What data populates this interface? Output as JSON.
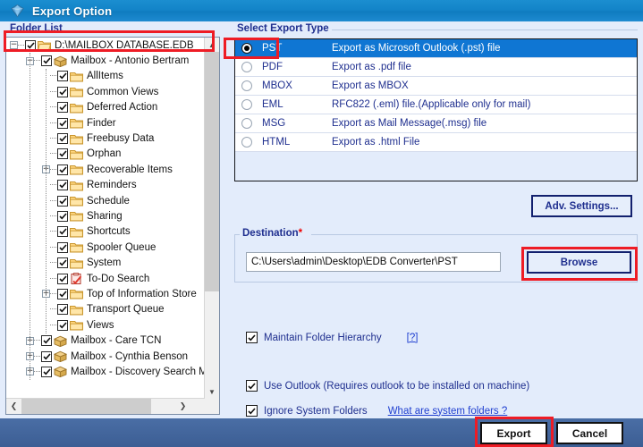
{
  "window": {
    "title": "Export Option",
    "icon": "gem-icon"
  },
  "left": {
    "group_label": "Folder List",
    "tree": [
      {
        "label": "D:\\MAILBOX DATABASE.EDB",
        "depth": 0,
        "expander": "minus",
        "icon": "open-folder-icon",
        "checked": true
      },
      {
        "label": "Mailbox - Antonio Bertram",
        "depth": 1,
        "expander": "minus",
        "icon": "mailbox-icon",
        "checked": true
      },
      {
        "label": "AllItems",
        "depth": 2,
        "expander": "none",
        "icon": "folder-icon",
        "checked": true
      },
      {
        "label": "Common Views",
        "depth": 2,
        "expander": "none",
        "icon": "folder-icon",
        "checked": true
      },
      {
        "label": "Deferred Action",
        "depth": 2,
        "expander": "none",
        "icon": "folder-icon",
        "checked": true
      },
      {
        "label": "Finder",
        "depth": 2,
        "expander": "none",
        "icon": "folder-icon",
        "checked": true
      },
      {
        "label": "Freebusy Data",
        "depth": 2,
        "expander": "none",
        "icon": "folder-icon",
        "checked": true
      },
      {
        "label": "Orphan",
        "depth": 2,
        "expander": "none",
        "icon": "folder-icon",
        "checked": true
      },
      {
        "label": "Recoverable Items",
        "depth": 2,
        "expander": "plus",
        "icon": "folder-icon",
        "checked": true
      },
      {
        "label": "Reminders",
        "depth": 2,
        "expander": "none",
        "icon": "folder-icon",
        "checked": true
      },
      {
        "label": "Schedule",
        "depth": 2,
        "expander": "none",
        "icon": "folder-icon",
        "checked": true
      },
      {
        "label": "Sharing",
        "depth": 2,
        "expander": "none",
        "icon": "folder-icon",
        "checked": true
      },
      {
        "label": "Shortcuts",
        "depth": 2,
        "expander": "none",
        "icon": "folder-icon",
        "checked": true
      },
      {
        "label": "Spooler Queue",
        "depth": 2,
        "expander": "none",
        "icon": "folder-icon",
        "checked": true
      },
      {
        "label": "System",
        "depth": 2,
        "expander": "none",
        "icon": "folder-icon",
        "checked": true
      },
      {
        "label": "To-Do Search",
        "depth": 2,
        "expander": "none",
        "icon": "todo-clipboard-icon",
        "checked": true
      },
      {
        "label": "Top of Information Store",
        "depth": 2,
        "expander": "plus",
        "icon": "folder-icon",
        "checked": true
      },
      {
        "label": "Transport Queue",
        "depth": 2,
        "expander": "none",
        "icon": "folder-icon",
        "checked": true
      },
      {
        "label": "Views",
        "depth": 2,
        "expander": "none",
        "icon": "folder-icon",
        "checked": true
      },
      {
        "label": "Mailbox - Care TCN",
        "depth": 1,
        "expander": "plus",
        "icon": "mailbox-icon",
        "checked": true
      },
      {
        "label": "Mailbox - Cynthia Benson",
        "depth": 1,
        "expander": "plus",
        "icon": "mailbox-icon",
        "checked": true
      },
      {
        "label": "Mailbox - Discovery Search Mailbox",
        "depth": 1,
        "expander": "plus",
        "icon": "mailbox-icon",
        "checked": true
      }
    ],
    "scrollbar": {
      "up_arrow": "▲",
      "down_arrow": "▼",
      "left_arrow": "❮",
      "right_arrow": "❯"
    }
  },
  "right": {
    "group_label": "Select Export Type",
    "export_types": [
      {
        "code": "PST",
        "description": "Export as Microsoft Outlook (.pst) file",
        "selected": true
      },
      {
        "code": "PDF",
        "description": "Export as .pdf file",
        "selected": false
      },
      {
        "code": "MBOX",
        "description": "Export as MBOX",
        "selected": false
      },
      {
        "code": "EML",
        "description": "RFC822 (.eml) file.(Applicable only for mail)",
        "selected": false
      },
      {
        "code": "MSG",
        "description": "Export as Mail Message(.msg) file",
        "selected": false
      },
      {
        "code": "HTML",
        "description": "Export as .html File",
        "selected": false
      }
    ],
    "adv_settings_label": "Adv. Settings...",
    "destination": {
      "group_label": "Destination",
      "required_mark": "*",
      "path_value": "C:\\Users\\admin\\Desktop\\EDB Converter\\PST",
      "browse_label": "Browse"
    },
    "options": [
      {
        "label": "Maintain Folder Hierarchy",
        "checked": true,
        "link": "[?]"
      },
      {
        "label": "Use Outlook (Requires outlook to be installed on machine)",
        "checked": true,
        "link": ""
      },
      {
        "label": "Ignore System Folders",
        "checked": true,
        "link": "What are system folders ?"
      }
    ]
  },
  "footer": {
    "export_label": "Export",
    "cancel_label": "Cancel"
  },
  "colors": {
    "titlebar": "#1384c8",
    "dialog_bg": "#e3ecfb",
    "selection": "#0f76d3",
    "label_blue": "#1f2f8f",
    "annotation_red": "#ee1c25",
    "footer_bar": "#3c5e94"
  }
}
